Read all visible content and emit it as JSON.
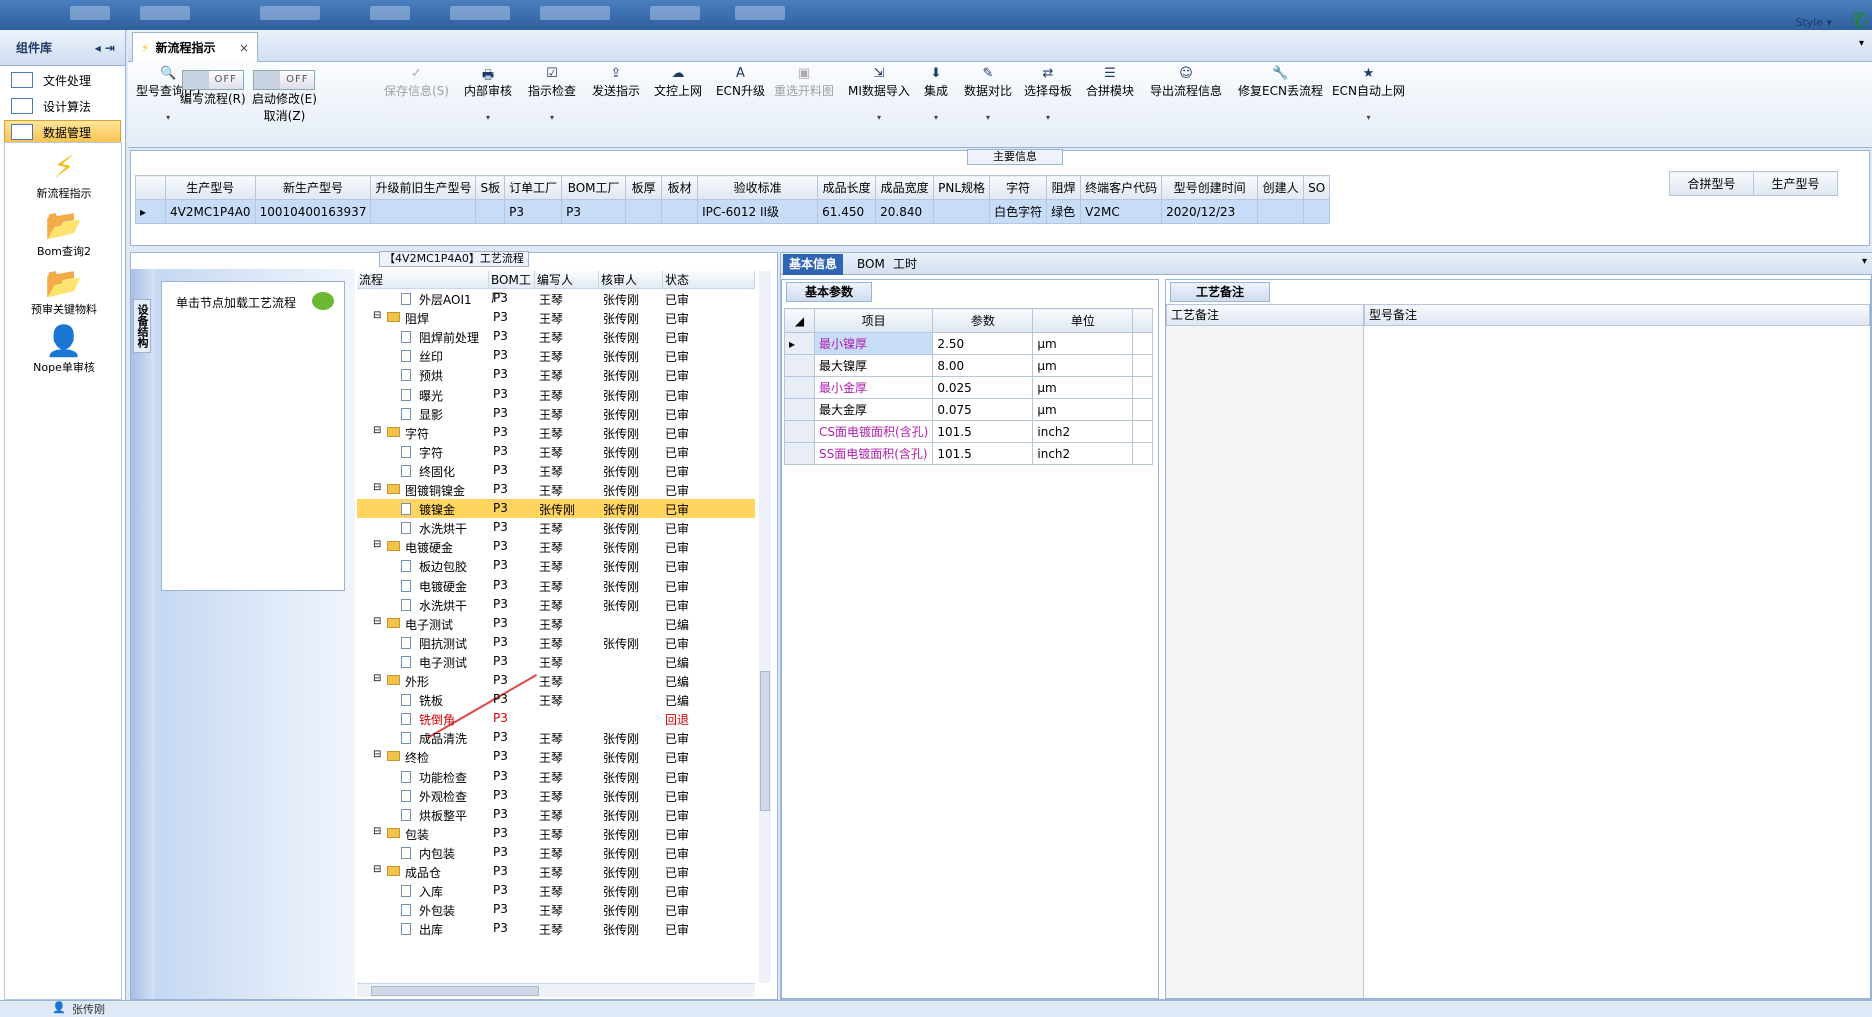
{
  "app": {
    "style_label": "Style ▾"
  },
  "sidebar": {
    "title": "组件库",
    "items": [
      {
        "label": "文件处理"
      },
      {
        "label": "设计算法"
      },
      {
        "label": "数据管理"
      }
    ],
    "library": [
      {
        "label": "新流程指示"
      },
      {
        "label": "Bom查询2"
      },
      {
        "label": "预审关键物料"
      },
      {
        "label": "Nope单审核"
      }
    ]
  },
  "tab": {
    "label": "新流程指示",
    "close": "×"
  },
  "toolbar": {
    "query": "型号查询(F)",
    "edit_flow": "编写流程(R)",
    "start_edit": "启动修改(E)",
    "cancel": "取消(Z)",
    "save": "保存信息(S)",
    "internal_review": "内部审核",
    "check": "指示检查",
    "send": "发送指示",
    "upload": "文控上网",
    "ecn_upgrade": "ECN升级",
    "reselect": "重选开料图",
    "mi_import": "MI数据导入",
    "integrate": "集成",
    "compare": "数据对比",
    "select_mother": "选择母板",
    "merge_module": "合拼模块",
    "export": "导出流程信息",
    "fix_ecn": "修复ECN丢流程",
    "ecn_auto": "ECN自动上网",
    "toggle_off": "OFF"
  },
  "main_info": {
    "caption": "主要信息",
    "headers": [
      "生产型号",
      "新生产型号",
      "升级前旧生产型号",
      "S板",
      "订单工厂",
      "BOM工厂",
      "板厚",
      "板材",
      "验收标准",
      "成品长度",
      "成品宽度",
      "PNL规格",
      "字符",
      "阻焊",
      "终端客户代码",
      "型号创建时间",
      "创建人",
      "SO"
    ],
    "row": [
      "4V2MC1P4A0",
      "10010400163937",
      "",
      "",
      "P3",
      "P3",
      "",
      "",
      "IPC-6012 II级",
      "61.450",
      "20.840",
      "",
      "白色字符",
      "绿色",
      "V2MC",
      "2020/12/23",
      "",
      ""
    ],
    "right_headers": [
      "合拼型号",
      "生产型号"
    ]
  },
  "process": {
    "caption": "【4V2MC1P4A0】工艺流程",
    "equip_label": "设备结构",
    "node_hint": "单击节点加载工艺流程",
    "headers": [
      "流程",
      "BOM工厂",
      "编写人",
      "核审人",
      "状态"
    ],
    "rows": [
      {
        "n": "外层AOI1",
        "l": 1,
        "f": "P3",
        "w": "王琴",
        "r": "张传刚",
        "s": "已审核"
      },
      {
        "n": "阻焊",
        "l": 0,
        "f": "P3",
        "w": "王琴",
        "r": "张传刚",
        "s": "已审核"
      },
      {
        "n": "阻焊前处理",
        "l": 1,
        "f": "P3",
        "w": "王琴",
        "r": "张传刚",
        "s": "已审核"
      },
      {
        "n": "丝印",
        "l": 1,
        "f": "P3",
        "w": "王琴",
        "r": "张传刚",
        "s": "已审核"
      },
      {
        "n": "预烘",
        "l": 1,
        "f": "P3",
        "w": "王琴",
        "r": "张传刚",
        "s": "已审核"
      },
      {
        "n": "曝光",
        "l": 1,
        "f": "P3",
        "w": "王琴",
        "r": "张传刚",
        "s": "已审核"
      },
      {
        "n": "显影",
        "l": 1,
        "f": "P3",
        "w": "王琴",
        "r": "张传刚",
        "s": "已审核"
      },
      {
        "n": "字符",
        "l": 0,
        "f": "P3",
        "w": "王琴",
        "r": "张传刚",
        "s": "已审核"
      },
      {
        "n": "字符",
        "l": 1,
        "f": "P3",
        "w": "王琴",
        "r": "张传刚",
        "s": "已审核"
      },
      {
        "n": "终固化",
        "l": 1,
        "f": "P3",
        "w": "王琴",
        "r": "张传刚",
        "s": "已审核"
      },
      {
        "n": "图镀铜镍金",
        "l": 0,
        "f": "P3",
        "w": "王琴",
        "r": "张传刚",
        "s": "已审核"
      },
      {
        "n": "镀镍金",
        "l": 1,
        "f": "P3",
        "w": "张传刚",
        "r": "张传刚",
        "s": "已审核",
        "hl": true
      },
      {
        "n": "水洗烘干",
        "l": 1,
        "f": "P3",
        "w": "王琴",
        "r": "张传刚",
        "s": "已审核"
      },
      {
        "n": "电镀硬金",
        "l": 0,
        "f": "P3",
        "w": "王琴",
        "r": "张传刚",
        "s": "已审核"
      },
      {
        "n": "板边包胶",
        "l": 1,
        "f": "P3",
        "w": "王琴",
        "r": "张传刚",
        "s": "已审核"
      },
      {
        "n": "电镀硬金",
        "l": 1,
        "f": "P3",
        "w": "王琴",
        "r": "张传刚",
        "s": "已审核"
      },
      {
        "n": "水洗烘干",
        "l": 1,
        "f": "P3",
        "w": "王琴",
        "r": "张传刚",
        "s": "已审核"
      },
      {
        "n": "电子测试",
        "l": 0,
        "f": "P3",
        "w": "王琴",
        "r": "",
        "s": "已编写"
      },
      {
        "n": "阻抗测试",
        "l": 1,
        "f": "P3",
        "w": "王琴",
        "r": "张传刚",
        "s": "已审核"
      },
      {
        "n": "电子测试",
        "l": 1,
        "f": "P3",
        "w": "王琴",
        "r": "",
        "s": "已编写"
      },
      {
        "n": "外形",
        "l": 0,
        "f": "P3",
        "w": "王琴",
        "r": "",
        "s": "已编写"
      },
      {
        "n": "铣板",
        "l": 1,
        "f": "P3",
        "w": "王琴",
        "r": "",
        "s": "已编写"
      },
      {
        "n": "铣倒角",
        "l": 1,
        "f": "P3",
        "w": "",
        "r": "",
        "s": "回退",
        "red": true
      },
      {
        "n": "成品清洗",
        "l": 1,
        "f": "P3",
        "w": "王琴",
        "r": "张传刚",
        "s": "已审核"
      },
      {
        "n": "终检",
        "l": 0,
        "f": "P3",
        "w": "王琴",
        "r": "张传刚",
        "s": "已审核"
      },
      {
        "n": "功能检查",
        "l": 1,
        "f": "P3",
        "w": "王琴",
        "r": "张传刚",
        "s": "已审核"
      },
      {
        "n": "外观检查",
        "l": 1,
        "f": "P3",
        "w": "王琴",
        "r": "张传刚",
        "s": "已审核"
      },
      {
        "n": "烘板整平",
        "l": 1,
        "f": "P3",
        "w": "王琴",
        "r": "张传刚",
        "s": "已审核"
      },
      {
        "n": "包装",
        "l": 0,
        "f": "P3",
        "w": "王琴",
        "r": "张传刚",
        "s": "已审核"
      },
      {
        "n": "内包装",
        "l": 1,
        "f": "P3",
        "w": "王琴",
        "r": "张传刚",
        "s": "已审核"
      },
      {
        "n": "成品仓",
        "l": 0,
        "f": "P3",
        "w": "王琴",
        "r": "张传刚",
        "s": "已审核"
      },
      {
        "n": "入库",
        "l": 1,
        "f": "P3",
        "w": "王琴",
        "r": "张传刚",
        "s": "已审核"
      },
      {
        "n": "外包装",
        "l": 1,
        "f": "P3",
        "w": "王琴",
        "r": "张传刚",
        "s": "已审核"
      },
      {
        "n": "出库",
        "l": 1,
        "f": "P3",
        "w": "王琴",
        "r": "张传刚",
        "s": "已审核"
      }
    ]
  },
  "right": {
    "tabs": [
      "基本信息",
      "BOM",
      "工时"
    ],
    "basic_group": "基本参数",
    "param_headers": [
      "项目",
      "参数",
      "单位"
    ],
    "params": [
      {
        "item": "最小镍厚",
        "val": "2.50",
        "unit": "μm",
        "mag": true
      },
      {
        "item": "最大镍厚",
        "val": "8.00",
        "unit": "μm"
      },
      {
        "item": "最小金厚",
        "val": "0.025",
        "unit": "μm",
        "mag": true
      },
      {
        "item": "最大金厚",
        "val": "0.075",
        "unit": "μm"
      },
      {
        "item": "CS面电镀面积(含孔)",
        "val": "101.5",
        "unit": "inch2",
        "mag": true
      },
      {
        "item": "SS面电镀面积(含孔)",
        "val": "101.5",
        "unit": "inch2",
        "mag": true
      }
    ],
    "remark_group": "工艺备注",
    "remark_h1": "工艺备注",
    "remark_h2": "型号备注"
  },
  "status": {
    "user": "张传刚"
  }
}
